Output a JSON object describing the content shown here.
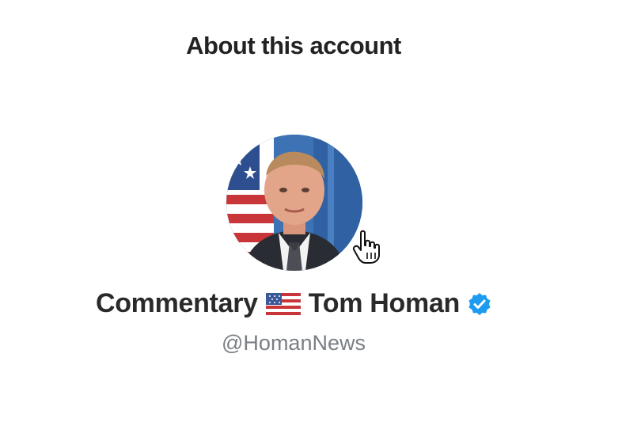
{
  "header": {
    "title": "About this account"
  },
  "profile": {
    "display_name_prefix": "Commentary",
    "flag": "us-flag-icon",
    "display_name": "Tom Homan",
    "verified": true,
    "handle": "@HomanNews"
  },
  "colors": {
    "verified_badge": "#1d9bf0",
    "handle_text": "#7a7f85",
    "primary_text": "#222222"
  }
}
